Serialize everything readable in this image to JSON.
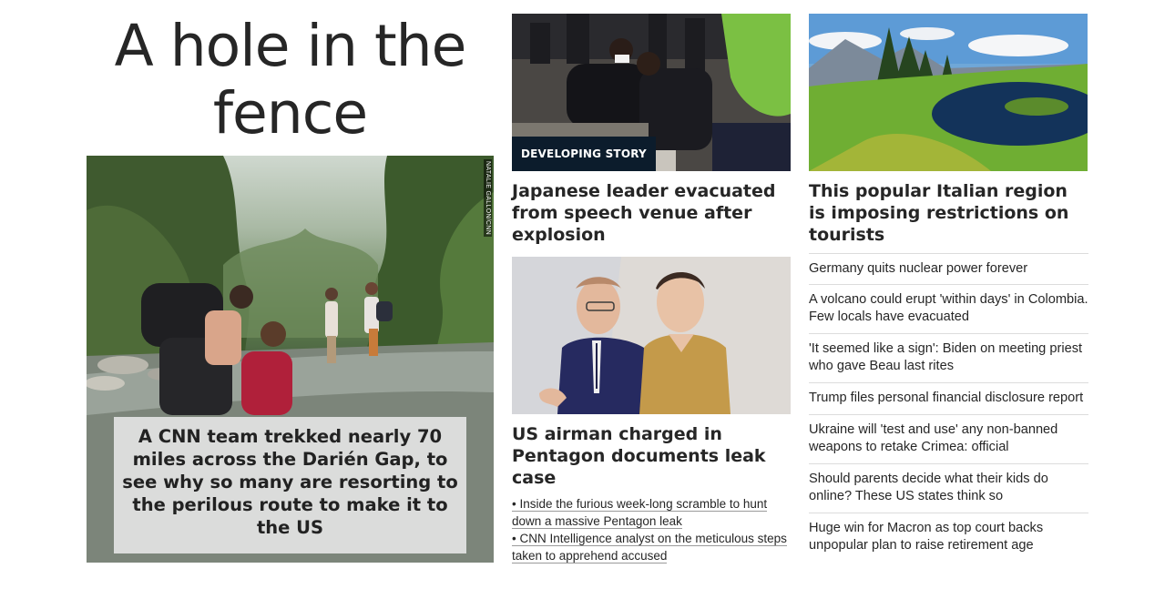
{
  "hero": {
    "title": "A hole in the fence",
    "photo_credit": "NATALIE GALLON/CNN",
    "caption": "A CNN team trekked nearly 70 miles across the Darién Gap, to see why so many are resorting to the perilous route to make it to the US"
  },
  "middle": {
    "story1": {
      "badge": "DEVELOPING STORY",
      "headline": "Japanese leader evacuated from speech venue after explosion"
    },
    "story2": {
      "headline": "US airman charged in Pentagon documents leak case",
      "related": [
        "• Inside the furious week-long scramble to hunt down a massive Pentagon leak",
        "• CNN Intelligence analyst on the meticulous steps taken to apprehend accused"
      ]
    }
  },
  "right": {
    "feature_headline": "This popular Italian region is imposing restrictions on tourists",
    "links": [
      "Germany quits nuclear power forever",
      "A volcano could erupt 'within days' in Colombia. Few locals have evacuated",
      "'It seemed like a sign': Biden on meeting priest who gave Beau last rites",
      "Trump files personal financial disclosure report",
      "Ukraine will 'test and use' any non-banned weapons to retake Crimea: official",
      "Should parents decide what their kids do online? These US states think so",
      "Huge win for Macron as top court backs unpopular plan to raise retirement age"
    ]
  },
  "colors": {
    "text": "#262626",
    "badge_bg": "#0c1c2c",
    "divider": "#dcdcdc"
  }
}
